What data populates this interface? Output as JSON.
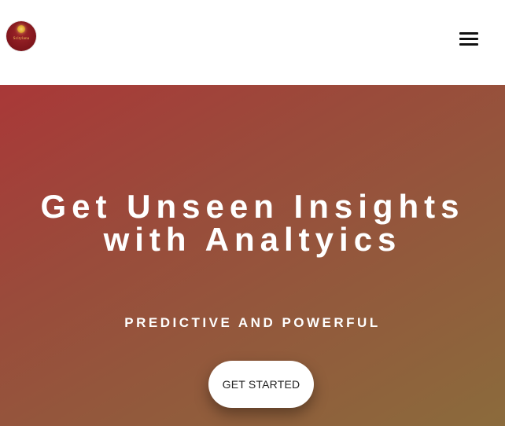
{
  "header": {
    "logo_text": "Scitylana",
    "menu_icon": "hamburger-menu-icon"
  },
  "hero": {
    "title_line1": "Get Unseen Insights",
    "title_line2": "with Analtyics",
    "subtitle": "PREDICTIVE AND POWERFUL",
    "cta_label": "GET STARTED"
  },
  "colors": {
    "hero_gradient_start": "#a93838",
    "hero_gradient_end": "#8b6b3c",
    "text": "#ffffff",
    "cta_background": "#ffffff"
  }
}
